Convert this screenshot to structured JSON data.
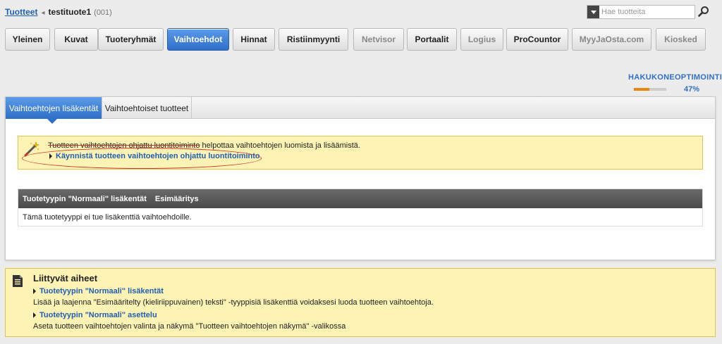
{
  "breadcrumb": {
    "root": "Tuotteet",
    "product": "testituote1",
    "code": "(001)"
  },
  "search": {
    "placeholder": "Hae tuotteita"
  },
  "main_tabs": [
    {
      "label": "Yleinen",
      "state": "normal"
    },
    {
      "label": "Kuvat",
      "state": "normal"
    },
    {
      "label": "Tuoteryhmät",
      "state": "normal"
    },
    {
      "label": "Vaihtoehdot",
      "state": "active"
    },
    {
      "label": "Hinnat",
      "state": "normal"
    },
    {
      "label": "Ristiinmyynti",
      "state": "normal"
    },
    {
      "label": "Netvisor",
      "state": "dim"
    },
    {
      "label": "Portaalit",
      "state": "normal"
    },
    {
      "label": "Logius",
      "state": "dim"
    },
    {
      "label": "ProCountor",
      "state": "normal"
    },
    {
      "label": "MyyJaOsta.com",
      "state": "dim"
    },
    {
      "label": "Kiosked",
      "state": "dim"
    }
  ],
  "seo": {
    "label": "HAKUKONEOPTIMOINTI",
    "percent_text": "47%",
    "progress": 0.47
  },
  "panel_tabs": [
    {
      "label": "Vaihtoehtojen lisäkentät",
      "active": true
    },
    {
      "label": "Vaihtoehtoiset tuotteet",
      "active": false
    }
  ],
  "wizard_note": {
    "text_struck": "Tuotteen vaihtoehtojen ohjattu luontitoiminto",
    "text_rest": " helpottaa vaihtoehtojen luomista ja lisäämistä.",
    "link": "Käynnistä tuotteen vaihtoehtojen ohjattu luontitoiminto"
  },
  "fields_table": {
    "header_title": "Tuotetyypin \"Normaali\" lisäkentät",
    "header_sub": "Esimääritys",
    "empty_text": "Tämä tuotetyyppi ei tue lisäkenttiä vaihtoehdoille."
  },
  "related": {
    "title": "Liittyvät aiheet",
    "items": [
      {
        "link": "Tuotetyypin \"Normaali\" lisäkentät",
        "desc": "Lisää ja laajenna \"Esimääritelty (kieliriippuvainen) teksti\" -tyyppisiä lisäkenttiä voidaksesi luoda tuotteen vaihtoehtoja."
      },
      {
        "link": "Tuotetyypin \"Normaali\" asettelu",
        "desc": "Aseta tuotteen vaihtoehtojen valinta ja näkymä \"Tuotteen vaihtoehtojen näkymä\" -valikossa"
      }
    ]
  },
  "colors": {
    "accent": "#2f6fc9",
    "link": "#1f5fb5",
    "note_bg": "#fdf3b4",
    "note_border": "#e2c34a",
    "progress": "#e8870f",
    "annotation": "#d0342c"
  }
}
